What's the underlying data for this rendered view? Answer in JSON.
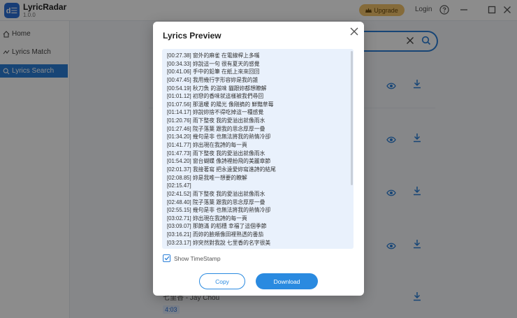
{
  "app": {
    "name": "LyricRadar",
    "version": "1.0.0",
    "logo_text": "d☰",
    "upgrade_label": "Upgrade",
    "login_label": "Login",
    "colors": {
      "accent": "#2a7fd8",
      "upgrade": "#f2c46a"
    },
    "icons": [
      "help-icon",
      "minimize-icon",
      "maximize-icon",
      "close-icon"
    ]
  },
  "sidebar": {
    "items": [
      {
        "label": "Home",
        "icon": "home-icon"
      },
      {
        "label": "Lyrics Match",
        "icon": "music-icon"
      },
      {
        "label": "Lyrics Search",
        "icon": "search-icon",
        "active": true
      }
    ]
  },
  "results": {
    "visible_song": {
      "title": "七里香 - Jay Chou",
      "duration": "4:03"
    }
  },
  "modal": {
    "title": "Lyrics Preview",
    "show_timestamp_label": "Show TimeStamp",
    "show_timestamp_checked": true,
    "copy_label": "Copy",
    "download_label": "Download",
    "lyrics": [
      "[00:27.38] 窗外的麻雀 在電線桿上多嘴",
      "[00:34.33] 妳說這一句 很有夏天的感覺",
      "[00:41.06] 手中的鉛筆 在紙上來來回回",
      "[00:47.45] 我用幾行字形容妳是我的誰",
      "[00:54.19] 秋刀魚 的滋味 貓跟妳都想瞭解",
      "[01:01.12] 初戀的香味就這樣被我們尋回",
      "[01:07.56] 那溫暖 的陽光 像剛摘的 鮮豔草莓",
      "[01:14.17] 妳說妳捨不得吃掉這一種感覺",
      "[01:20.76] 雨下整夜 我的愛溢出就像雨水",
      "[01:27.46] 院子落葉 跟我的思念厚厚一疊",
      "[01:34.20] 幾句是非 也無法將我的熱情冷卻",
      "[01:41.77] 妳出現在我詩的每一頁",
      "[01:47.73] 雨下整夜 我的愛溢出就像雨水",
      "[01:54.20] 窗台蝴蝶 像詩裡紛飛的美麗章節",
      "[02:01.37] 我接著寫 把永遠愛妳寫進詩的結尾",
      "[02:08.85] 妳是我唯一想要的瞭解",
      "[02:15.47]",
      "[02:41.52] 雨下整夜 我的愛溢出就像雨水",
      "[02:48.40] 院子落葉 跟我的思念厚厚一疊",
      "[02:55.15] 幾句是非 也無法將我的熱情冷卻",
      "[03:02.71] 妳出現在我詩的每一頁",
      "[03:09.07] 那飽滿 的稻穗 幸福了這個季節",
      "[03:16.21] 而妳的臉頰像田裡熟透的番茄",
      "[03:23.17] 妳突然對我說 七里香的名字很美"
    ]
  }
}
